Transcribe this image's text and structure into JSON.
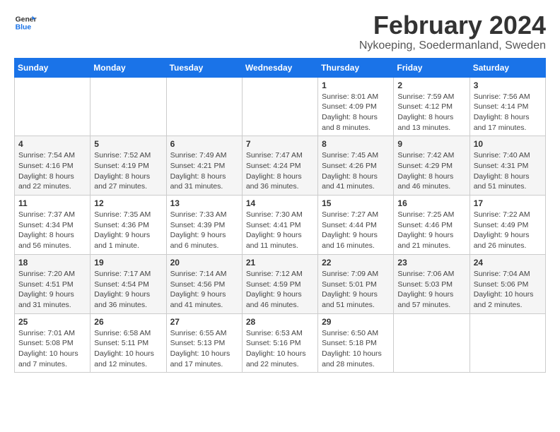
{
  "logo": {
    "text_general": "General",
    "text_blue": "Blue"
  },
  "header": {
    "month_year": "February 2024",
    "location": "Nykoeping, Soedermanland, Sweden"
  },
  "weekdays": [
    "Sunday",
    "Monday",
    "Tuesday",
    "Wednesday",
    "Thursday",
    "Friday",
    "Saturday"
  ],
  "weeks": [
    [
      {
        "day": "",
        "info": ""
      },
      {
        "day": "",
        "info": ""
      },
      {
        "day": "",
        "info": ""
      },
      {
        "day": "",
        "info": ""
      },
      {
        "day": "1",
        "info": "Sunrise: 8:01 AM\nSunset: 4:09 PM\nDaylight: 8 hours\nand 8 minutes."
      },
      {
        "day": "2",
        "info": "Sunrise: 7:59 AM\nSunset: 4:12 PM\nDaylight: 8 hours\nand 13 minutes."
      },
      {
        "day": "3",
        "info": "Sunrise: 7:56 AM\nSunset: 4:14 PM\nDaylight: 8 hours\nand 17 minutes."
      }
    ],
    [
      {
        "day": "4",
        "info": "Sunrise: 7:54 AM\nSunset: 4:16 PM\nDaylight: 8 hours\nand 22 minutes."
      },
      {
        "day": "5",
        "info": "Sunrise: 7:52 AM\nSunset: 4:19 PM\nDaylight: 8 hours\nand 27 minutes."
      },
      {
        "day": "6",
        "info": "Sunrise: 7:49 AM\nSunset: 4:21 PM\nDaylight: 8 hours\nand 31 minutes."
      },
      {
        "day": "7",
        "info": "Sunrise: 7:47 AM\nSunset: 4:24 PM\nDaylight: 8 hours\nand 36 minutes."
      },
      {
        "day": "8",
        "info": "Sunrise: 7:45 AM\nSunset: 4:26 PM\nDaylight: 8 hours\nand 41 minutes."
      },
      {
        "day": "9",
        "info": "Sunrise: 7:42 AM\nSunset: 4:29 PM\nDaylight: 8 hours\nand 46 minutes."
      },
      {
        "day": "10",
        "info": "Sunrise: 7:40 AM\nSunset: 4:31 PM\nDaylight: 8 hours\nand 51 minutes."
      }
    ],
    [
      {
        "day": "11",
        "info": "Sunrise: 7:37 AM\nSunset: 4:34 PM\nDaylight: 8 hours\nand 56 minutes."
      },
      {
        "day": "12",
        "info": "Sunrise: 7:35 AM\nSunset: 4:36 PM\nDaylight: 9 hours\nand 1 minute."
      },
      {
        "day": "13",
        "info": "Sunrise: 7:33 AM\nSunset: 4:39 PM\nDaylight: 9 hours\nand 6 minutes."
      },
      {
        "day": "14",
        "info": "Sunrise: 7:30 AM\nSunset: 4:41 PM\nDaylight: 9 hours\nand 11 minutes."
      },
      {
        "day": "15",
        "info": "Sunrise: 7:27 AM\nSunset: 4:44 PM\nDaylight: 9 hours\nand 16 minutes."
      },
      {
        "day": "16",
        "info": "Sunrise: 7:25 AM\nSunset: 4:46 PM\nDaylight: 9 hours\nand 21 minutes."
      },
      {
        "day": "17",
        "info": "Sunrise: 7:22 AM\nSunset: 4:49 PM\nDaylight: 9 hours\nand 26 minutes."
      }
    ],
    [
      {
        "day": "18",
        "info": "Sunrise: 7:20 AM\nSunset: 4:51 PM\nDaylight: 9 hours\nand 31 minutes."
      },
      {
        "day": "19",
        "info": "Sunrise: 7:17 AM\nSunset: 4:54 PM\nDaylight: 9 hours\nand 36 minutes."
      },
      {
        "day": "20",
        "info": "Sunrise: 7:14 AM\nSunset: 4:56 PM\nDaylight: 9 hours\nand 41 minutes."
      },
      {
        "day": "21",
        "info": "Sunrise: 7:12 AM\nSunset: 4:59 PM\nDaylight: 9 hours\nand 46 minutes."
      },
      {
        "day": "22",
        "info": "Sunrise: 7:09 AM\nSunset: 5:01 PM\nDaylight: 9 hours\nand 51 minutes."
      },
      {
        "day": "23",
        "info": "Sunrise: 7:06 AM\nSunset: 5:03 PM\nDaylight: 9 hours\nand 57 minutes."
      },
      {
        "day": "24",
        "info": "Sunrise: 7:04 AM\nSunset: 5:06 PM\nDaylight: 10 hours\nand 2 minutes."
      }
    ],
    [
      {
        "day": "25",
        "info": "Sunrise: 7:01 AM\nSunset: 5:08 PM\nDaylight: 10 hours\nand 7 minutes."
      },
      {
        "day": "26",
        "info": "Sunrise: 6:58 AM\nSunset: 5:11 PM\nDaylight: 10 hours\nand 12 minutes."
      },
      {
        "day": "27",
        "info": "Sunrise: 6:55 AM\nSunset: 5:13 PM\nDaylight: 10 hours\nand 17 minutes."
      },
      {
        "day": "28",
        "info": "Sunrise: 6:53 AM\nSunset: 5:16 PM\nDaylight: 10 hours\nand 22 minutes."
      },
      {
        "day": "29",
        "info": "Sunrise: 6:50 AM\nSunset: 5:18 PM\nDaylight: 10 hours\nand 28 minutes."
      },
      {
        "day": "",
        "info": ""
      },
      {
        "day": "",
        "info": ""
      }
    ]
  ]
}
